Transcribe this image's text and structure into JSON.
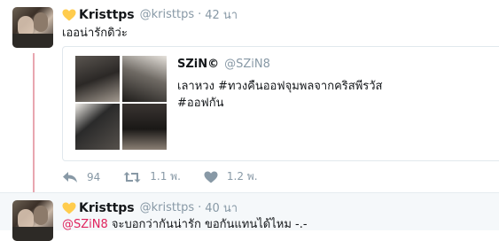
{
  "tweet1": {
    "display_name": "Kristtps",
    "handle": "@kristtps",
    "separator": "·",
    "time": "42 นา",
    "text": "เออน่ารักดิว่ะ",
    "quote": {
      "display_name": "SZiN©",
      "handle": "@SZiN8",
      "line1": "เลาหวง #ทวงคืนออฟจุมพลจากคริสพีรวัส",
      "line2": "#ออฟกัน"
    },
    "actions": {
      "reply_count": "94",
      "retweet_count": "1.1 พ.",
      "like_count": "1.2 พ."
    }
  },
  "tweet2": {
    "display_name": "Kristtps",
    "handle": "@kristtps",
    "separator": "·",
    "time": "40 นา",
    "mention": "@SZiN8",
    "text": " จะบอกว่ากันน่ารัก ขอกันแทนได้ไหม -.-"
  },
  "colors": {
    "heart": "#ffcc4d",
    "mention": "#e0245e",
    "muted": "#8899a6",
    "thread_line": "#e8a6b0"
  },
  "icons": [
    "heart-emoji-icon",
    "reply-icon",
    "retweet-icon",
    "like-icon"
  ]
}
